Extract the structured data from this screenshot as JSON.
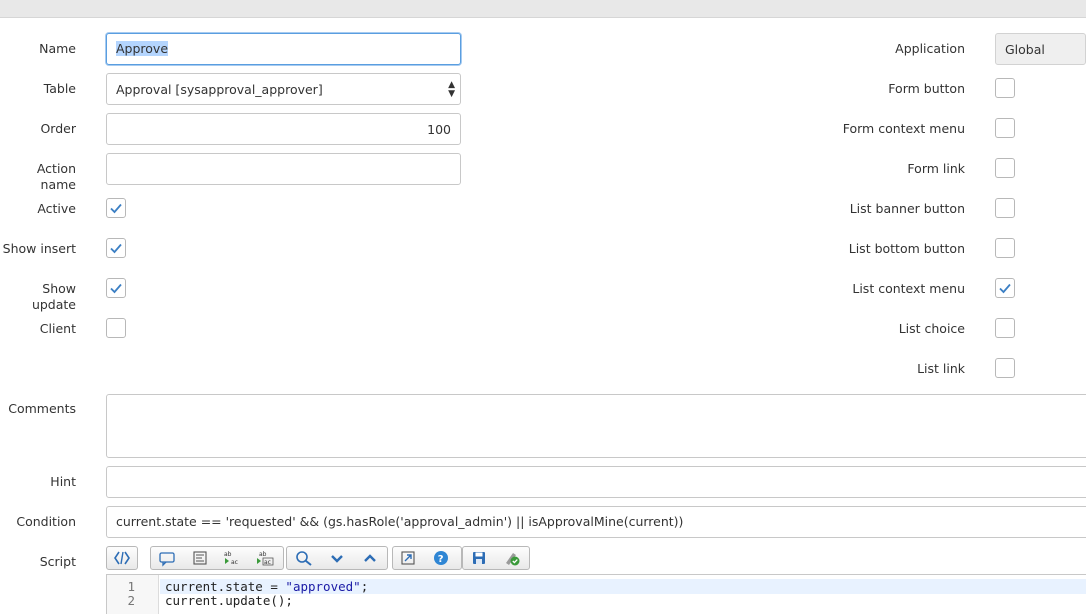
{
  "form": {
    "name_label": "Name",
    "name_value": "Approve",
    "table_label": "Table",
    "table_value": "Approval [sysapproval_approver]",
    "order_label": "Order",
    "order_value": "100",
    "action_name_label": "Action name",
    "action_name_value": "",
    "active_label": "Active",
    "active_checked": true,
    "show_insert_label": "Show insert",
    "show_insert_checked": true,
    "show_update_label": "Show update",
    "show_update_checked": true,
    "client_label": "Client",
    "client_checked": false,
    "application_label": "Application",
    "application_value": "Global",
    "form_button_label": "Form button",
    "form_button_checked": false,
    "form_context_menu_label": "Form context menu",
    "form_context_menu_checked": false,
    "form_link_label": "Form link",
    "form_link_checked": false,
    "list_banner_button_label": "List banner button",
    "list_banner_button_checked": false,
    "list_bottom_button_label": "List bottom button",
    "list_bottom_button_checked": false,
    "list_context_menu_label": "List context menu",
    "list_context_menu_checked": true,
    "list_choice_label": "List choice",
    "list_choice_checked": false,
    "list_link_label": "List link",
    "list_link_checked": false,
    "comments_label": "Comments",
    "comments_value": "",
    "hint_label": "Hint",
    "hint_value": "",
    "condition_label": "Condition",
    "condition_value": "current.state == 'requested' && (gs.hasRole('approval_admin') || isApprovalMine(current))",
    "script_label": "Script"
  },
  "script_toolbar": {
    "icons": [
      "toggle-syntax-icon",
      "comment-icon",
      "format-code-icon",
      "replace-icon",
      "replace-all-icon",
      "search-icon",
      "collapse-icon",
      "expand-icon",
      "fullscreen-icon",
      "help-icon",
      "save-icon",
      "syntax-check-icon"
    ]
  },
  "editor": {
    "line1_number": "1",
    "line1_code_a": "current.state = ",
    "line1_code_str": "\"approved\"",
    "line1_code_b": ";",
    "line2_number": "2",
    "line2_code": "current.update();"
  },
  "colors": {
    "accent": "#3b7fc4",
    "focus_border": "#5a9ee0",
    "selection": "#b4d5fe"
  }
}
